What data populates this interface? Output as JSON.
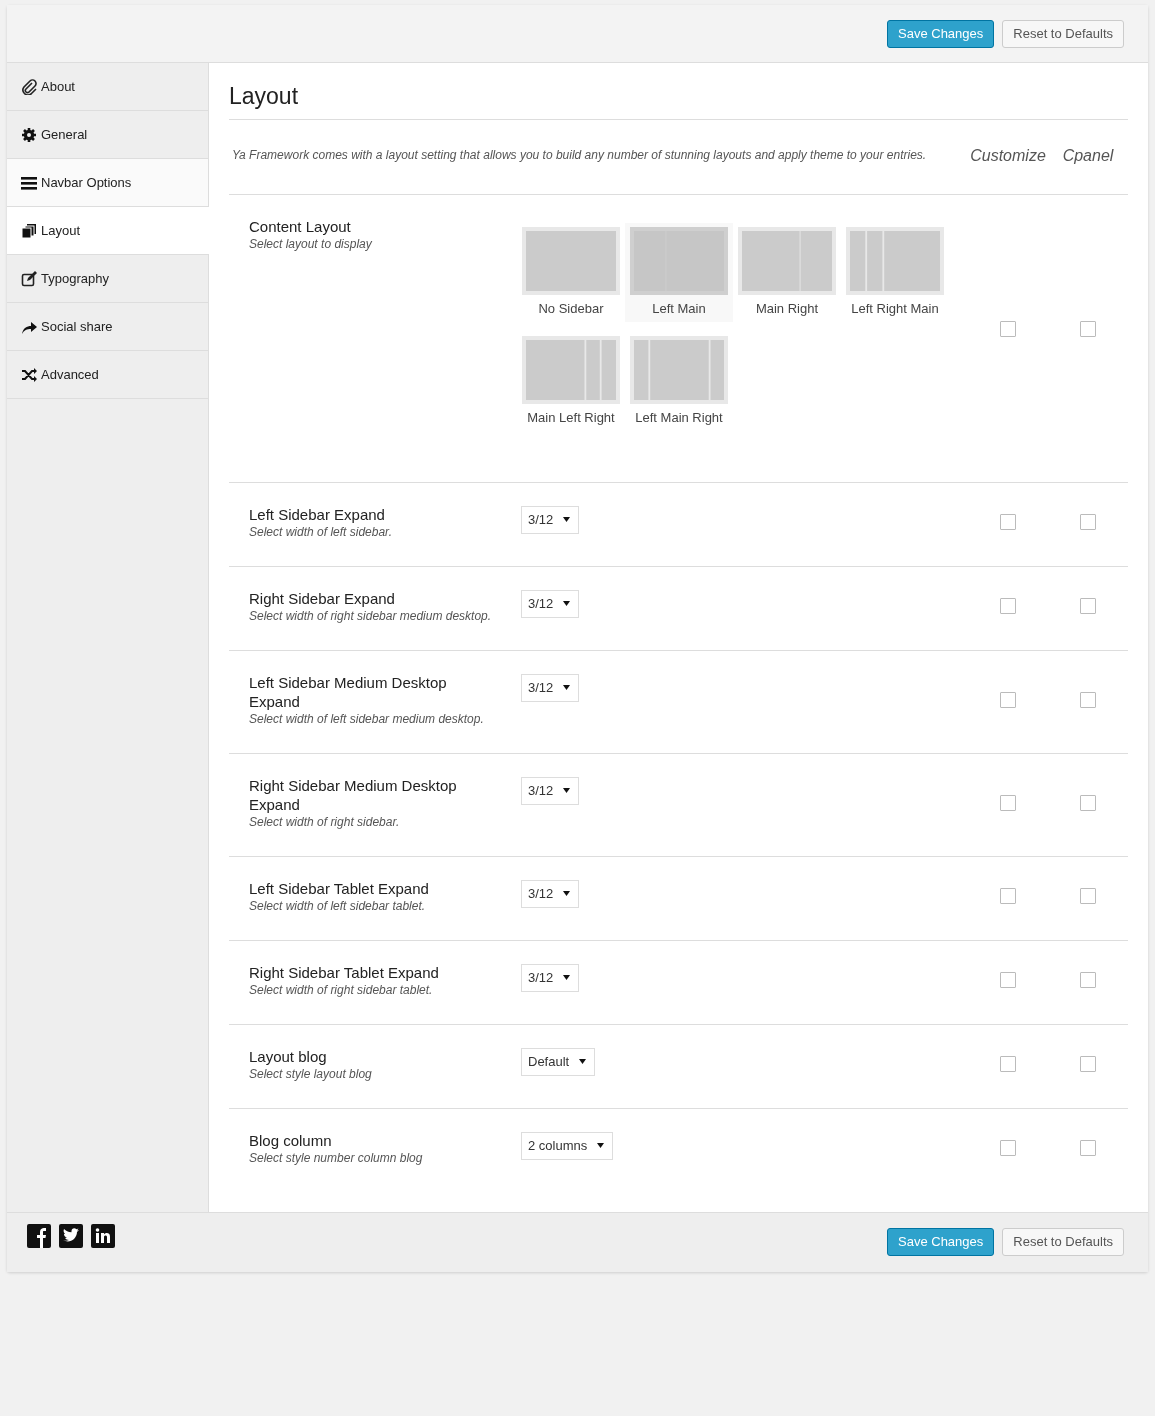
{
  "header": {
    "buttons": [
      {
        "label": "Save Changes",
        "kind": "primary"
      },
      {
        "label": "Reset to Defaults",
        "kind": "secondary"
      }
    ]
  },
  "sidebar": {
    "items": [
      {
        "label": "About",
        "selected": false,
        "hovered": false
      },
      {
        "label": "General",
        "selected": false,
        "hovered": false
      },
      {
        "label": "Navbar Options",
        "selected": false,
        "hovered": true
      },
      {
        "label": "Layout",
        "selected": true,
        "hovered": false
      },
      {
        "label": "Typography",
        "selected": false,
        "hovered": false
      },
      {
        "label": "Social share",
        "selected": false,
        "hovered": false
      },
      {
        "label": "Advanced",
        "selected": false,
        "hovered": false
      }
    ]
  },
  "section": {
    "title": "Layout",
    "intro": "Ya Framework comes with a layout setting that allows you to build any number of stunning layouts and apply theme to your entries.",
    "column_headers": [
      "Customize",
      "Cpanel"
    ]
  },
  "options": [
    {
      "title": "Content Layout",
      "description": "Select layout to display",
      "kind": "layout-picker",
      "choices": [
        {
          "label": "No Sidebar",
          "kind": "no-sidebar",
          "selected": false
        },
        {
          "label": "Left Main",
          "kind": "left-main",
          "selected": true
        },
        {
          "label": "Main Right",
          "kind": "main-right",
          "selected": false
        },
        {
          "label": "Left Right Main",
          "kind": "left-right-main",
          "selected": false
        },
        {
          "label": "Main Left Right",
          "kind": "main-left-right",
          "selected": false
        },
        {
          "label": "Left Main Right",
          "kind": "left-main-right",
          "selected": false
        }
      ],
      "customize": false,
      "cpanel": false
    },
    {
      "title": "Left Sidebar Expand",
      "description": "Select width of left sidebar.",
      "kind": "select",
      "value": "3/12",
      "customize": false,
      "cpanel": false
    },
    {
      "title": "Right Sidebar Expand",
      "description": "Select width of right sidebar medium desktop.",
      "kind": "select",
      "value": "3/12",
      "customize": false,
      "cpanel": false
    },
    {
      "title": "Left Sidebar Medium Desktop Expand",
      "description": "Select width of left sidebar medium desktop.",
      "kind": "select",
      "value": "3/12",
      "customize": false,
      "cpanel": false
    },
    {
      "title": "Right Sidebar Medium Desktop Expand",
      "description": "Select width of right sidebar.",
      "kind": "select",
      "value": "3/12",
      "customize": false,
      "cpanel": false
    },
    {
      "title": "Left Sidebar Tablet Expand",
      "description": "Select width of left sidebar tablet.",
      "kind": "select",
      "value": "3/12",
      "customize": false,
      "cpanel": false
    },
    {
      "title": "Right Sidebar Tablet Expand",
      "description": "Select width of right sidebar tablet.",
      "kind": "select",
      "value": "3/12",
      "customize": false,
      "cpanel": false
    },
    {
      "title": "Layout blog",
      "description": "Select style layout blog",
      "kind": "select",
      "value": "Default",
      "customize": false,
      "cpanel": false
    },
    {
      "title": "Blog column",
      "description": "Select style number column blog",
      "kind": "select",
      "value": "2 columns",
      "customize": false,
      "cpanel": false
    }
  ],
  "footer": {
    "buttons": [
      {
        "label": "Save Changes",
        "kind": "primary"
      },
      {
        "label": "Reset to Defaults",
        "kind": "secondary"
      }
    ]
  }
}
